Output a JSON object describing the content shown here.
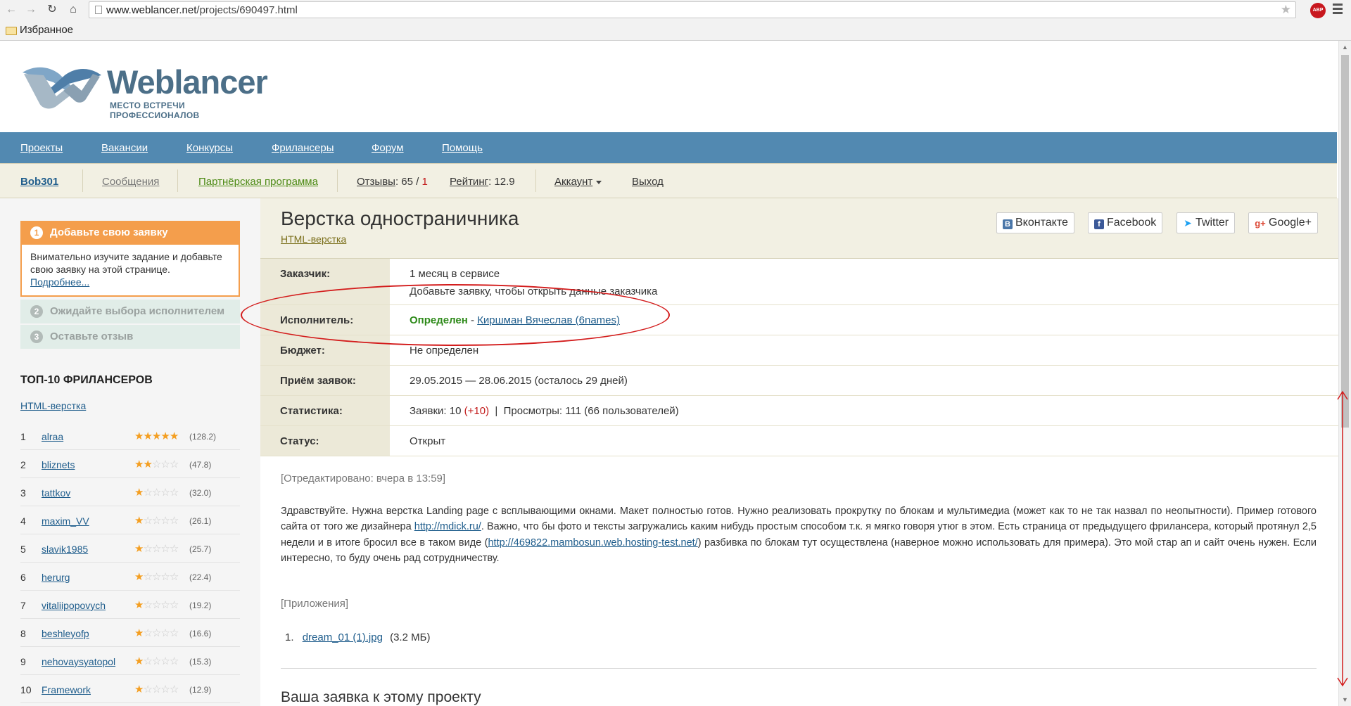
{
  "browser": {
    "url_host": "www.weblancer.net",
    "url_path": "/projects/690497.html",
    "bookmarks_label": "Избранное",
    "abp_label": "ABP"
  },
  "site": {
    "logo_title": "Weblancer",
    "logo_subtitle": "МЕСТО ВСТРЕЧИ ПРОФЕССИОНАЛОВ"
  },
  "nav": [
    "Проекты",
    "Вакансии",
    "Конкурсы",
    "Фрилансеры",
    "Форум",
    "Помощь"
  ],
  "userbar": {
    "username": "Bob301",
    "messages": "Сообщения",
    "partner": "Партнёрская программа",
    "reviews_label": "Отзывы",
    "reviews_text": ": 65 / ",
    "reviews_negative": "1",
    "rating_label": "Рейтинг",
    "rating_text": ": 12.9",
    "account": "Аккаунт",
    "logout": "Выход"
  },
  "sidebar": {
    "steps": [
      {
        "num": "1",
        "label": "Добавьте свою заявку"
      },
      {
        "num": "2",
        "label": "Ожидайте выбора исполнителем"
      },
      {
        "num": "3",
        "label": "Оставьте отзыв"
      }
    ],
    "step1_text": "Внимательно изучите задание и добавьте свою заявку на этой странице.",
    "step1_link": "Подробнее...",
    "top10_title": "ТОП-10 ФРИЛАНСЕРОВ",
    "top10_category": "HTML-верстка",
    "freelancers": [
      {
        "rank": "1",
        "name": "alraa",
        "stars": 5,
        "rating": "(128.2)"
      },
      {
        "rank": "2",
        "name": "bliznets",
        "stars": 2,
        "rating": "(47.8)"
      },
      {
        "rank": "3",
        "name": "tattkov",
        "stars": 1,
        "rating": "(32.0)"
      },
      {
        "rank": "4",
        "name": "maxim_VV",
        "stars": 1,
        "rating": "(26.1)"
      },
      {
        "rank": "5",
        "name": "slavik1985",
        "stars": 1,
        "rating": "(25.7)"
      },
      {
        "rank": "6",
        "name": "herurg",
        "stars": 1,
        "rating": "(22.4)"
      },
      {
        "rank": "7",
        "name": "vitaliipopovych",
        "stars": 1,
        "rating": "(19.2)"
      },
      {
        "rank": "8",
        "name": "beshleyofp",
        "stars": 1,
        "rating": "(16.6)"
      },
      {
        "rank": "9",
        "name": "nehovaysyatopol",
        "stars": 1,
        "rating": "(15.3)"
      },
      {
        "rank": "10",
        "name": "Framework",
        "stars": 1,
        "rating": "(12.9)"
      }
    ]
  },
  "project": {
    "title": "Верстка одностраничника",
    "category": "HTML-верстка",
    "share": [
      "Вконтакте",
      "Facebook",
      "Twitter",
      "Google+"
    ],
    "customer_label": "Заказчик:",
    "customer_value": "1 месяц в сервисе",
    "customer_hint": "Добавьте заявку, чтобы открыть данные заказчика",
    "executor_label": "Исполнитель:",
    "executor_status": "Определен",
    "executor_dash": " - ",
    "executor_name": "Киршман Вячеслав (6names)",
    "budget_label": "Бюджет:",
    "budget_value": "Не определен",
    "bids_label": "Приём заявок:",
    "bids_value": "29.05.2015 — 28.06.2015 (осталось 29 дней)",
    "stats_label": "Статистика:",
    "stats_bids": "Заявки: 10 ",
    "stats_bids_new": "(+10)",
    "stats_sep": "  |  ",
    "stats_views": "Просмотры: 111 (66 пользователей)",
    "status_label": "Статус:",
    "status_value": "Открыт",
    "edited": "[Отредактировано: вчера в 13:59]",
    "desc_1": "Здравствуйте. Нужна верстка Landing page с всплывающими окнами. Макет полностью готов. Нужно реализовать прокрутку по блокам и мультимедиа (может как то не так назвал по неопытности). Пример готового сайта от того же дизайнера ",
    "desc_link1": "http://mdick.ru/",
    "desc_2": ". Важно, что бы фото и тексты загружались каким нибудь простым способом т.к. я мягко говоря утюг в этом. Есть страница от предыдущего фрилансера, который протянул 2,5 недели и в итоге бросил все в таком виде (",
    "desc_link2": "http://469822.mambosun.web.hosting-test.net/",
    "desc_3": ") разбивка по блокам тут осуществлена (наверное можно использовать для примера). Это мой стар ап и сайт очень нужен. Если интересно, то буду очень рад сотрудничеству.",
    "attachments_label": "[Приложения]",
    "attachment_num": "1.",
    "attachment_name": "dream_01 (1).jpg",
    "attachment_size": "(3.2 МБ)",
    "bid_section_title": "Ваша заявка к этому проекту"
  },
  "colors": {
    "nav_blue": "#5289b1",
    "accent_orange": "#f49e4c",
    "annotation_red": "#d31c1c"
  }
}
